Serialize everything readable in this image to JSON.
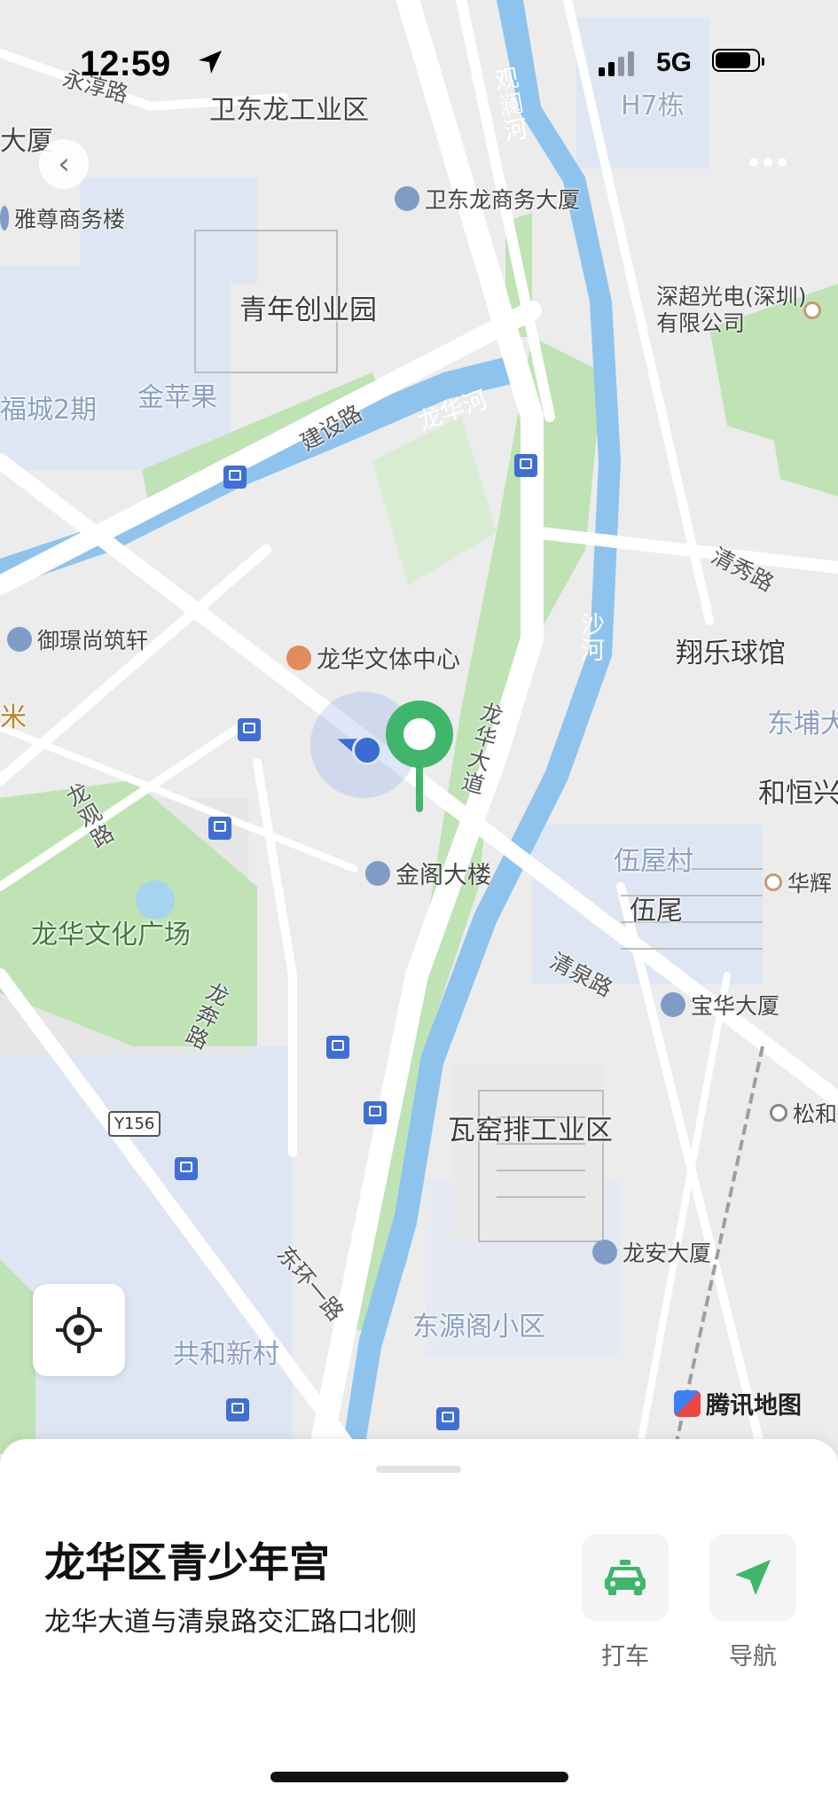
{
  "status_bar": {
    "time": "12:59",
    "network": "5G",
    "battery_level": 0.85
  },
  "map": {
    "labels": {
      "weidonglong_industrial": "卫东龙工业区",
      "yongchun_road": "永淳路",
      "dasha_left": "大厦",
      "guanlan_river": "观澜河",
      "h7": "H7栋",
      "weidonglong_business": "卫东龙商务大厦",
      "yazun": "雅尊商务楼",
      "youth_park": "青年创业园",
      "shenchao": "深超光电(深圳)有限公司",
      "jinpingguo": "金苹果",
      "fucheng": "福城2期",
      "jianshe_road": "建设路",
      "longhua_river": "龙华河",
      "qingxiu_road": "清秀路",
      "sha_river": "沙河",
      "yujing": "御璟尚筑轩",
      "sports_center": "龙华文体中心",
      "xiangle": "翔乐球馆",
      "dongpu": "东埔大",
      "mi": "米",
      "heheng": "和恒兴",
      "longhua_avenue": "龙华大道",
      "longguan_road": "龙观路",
      "jinge": "金阁大楼",
      "wuwu_village": "伍屋村",
      "huahui": "华辉",
      "wuwei": "伍尾",
      "culture_square": "龙华文化广场",
      "qingquan_road": "清泉路",
      "baohua": "宝华大厦",
      "longben_road": "龙奔路",
      "y156": "Y156",
      "songhe": "松和",
      "wayaopai": "瓦窑排工业区",
      "longan": "龙安大厦",
      "donghuan_road": "东环一路",
      "dongyuange": "东源阁小区",
      "gonghe": "共和新村",
      "logo": "腾讯地图"
    }
  },
  "place": {
    "title": "龙华区青少年宫",
    "address": "龙华大道与清泉路交汇路口北侧"
  },
  "actions": {
    "taxi_label": "打车",
    "navigate_label": "导航"
  },
  "colors": {
    "accent": "#3fb66b",
    "water": "#8ec3ee",
    "park": "#bfe3b4"
  }
}
